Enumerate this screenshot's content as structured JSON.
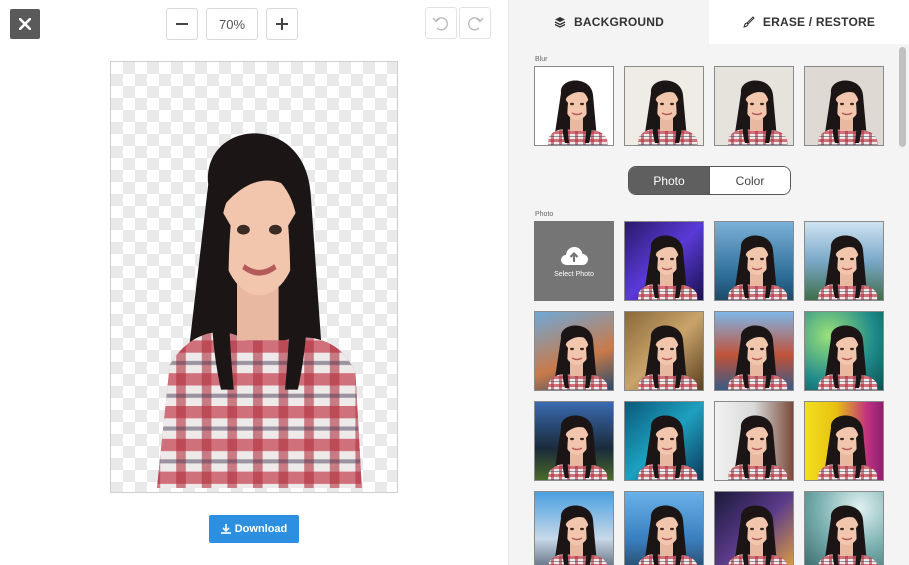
{
  "toolbar": {
    "zoom_value": "70%",
    "download_label": "Download"
  },
  "panel": {
    "tabs": [
      {
        "label": "BACKGROUND",
        "icon": "layers-icon"
      },
      {
        "label": "ERASE / RESTORE",
        "icon": "brush-icon"
      }
    ],
    "blur_label": "Blur",
    "toggle": {
      "photo": "Photo",
      "color": "Color",
      "selected": "Photo"
    },
    "photo_label": "Photo",
    "select_photo_label": "Select Photo"
  },
  "colors": {
    "accent": "#2d8fe0",
    "toggle_active": "#5f5f5f",
    "close_bg": "#5a5a5a"
  }
}
